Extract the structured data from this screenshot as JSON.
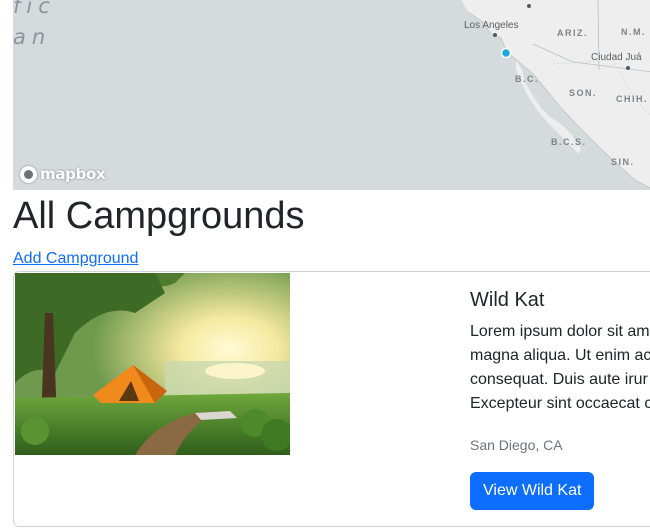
{
  "map": {
    "ocean_label_line1": "fic",
    "ocean_label_line2": "an",
    "labels": {
      "los_angeles": "Los Angeles",
      "ciudad_juarez": "Ciudad Juá",
      "ariz": "ARIZ.",
      "nm": "N.M.",
      "bc": "B.C.",
      "son": "SON.",
      "chih": "CHIH.",
      "bcs": "B.C.S.",
      "sin": "SIN."
    },
    "attribution_logo": "mapbox",
    "marker_color": "#1fa8e0"
  },
  "page": {
    "title": "All Campgrounds",
    "add_link": "Add Campground"
  },
  "campgrounds": [
    {
      "title": "Wild Kat",
      "description_lines": [
        "Lorem ipsum dolor sit am",
        "magna aliqua. Ut enim ac",
        "consequat. Duis aute irur",
        "Excepteur sint occaecat c"
      ],
      "location": "San Diego, CA",
      "button_label": "View Wild Kat"
    }
  ]
}
